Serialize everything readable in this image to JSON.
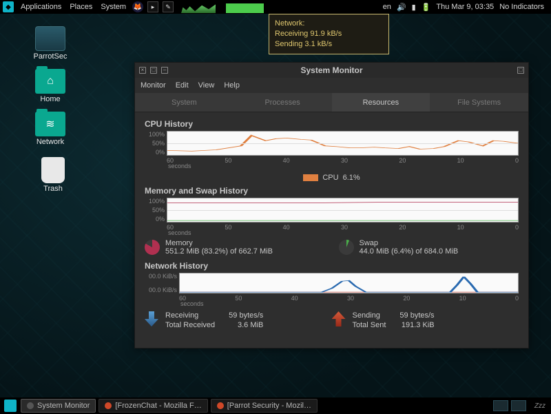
{
  "top_panel": {
    "menus": [
      "Applications",
      "Places",
      "System"
    ],
    "lang": "en",
    "datetime": "Thu Mar  9, 03:35",
    "indicators": "No Indicators"
  },
  "tooltip": {
    "title": "Network:",
    "recv": "Receiving 91.9 kB/s",
    "send": "Sending 3.1 kB/s"
  },
  "desktop_icons": {
    "parrot": "ParrotSec",
    "home": "Home",
    "network": "Network",
    "trash": "Trash"
  },
  "window": {
    "title": "System Monitor",
    "menus": [
      "Monitor",
      "Edit",
      "View",
      "Help"
    ],
    "tabs": [
      "System",
      "Processes",
      "Resources",
      "File Systems"
    ],
    "active_tab": 2,
    "cpu": {
      "title": "CPU History",
      "ylabels": [
        "100%",
        "50%",
        "0%"
      ],
      "xlabels": [
        "60",
        "50",
        "40",
        "30",
        "20",
        "10",
        "0"
      ],
      "xunit": "seconds",
      "legend_label": "CPU",
      "legend_value": "6.1%",
      "color": "#e08040"
    },
    "mem": {
      "title": "Memory and Swap History",
      "ylabels": [
        "100%",
        "50%",
        "0%"
      ],
      "xlabels": [
        "60",
        "50",
        "40",
        "30",
        "20",
        "10",
        "0"
      ],
      "xunit": "seconds",
      "memory_label": "Memory",
      "memory_line": "551.2 MiB (83.2%) of 662.7 MiB",
      "swap_label": "Swap",
      "swap_line": "44.0 MiB (6.4%) of 684.0 MiB"
    },
    "net": {
      "title": "Network History",
      "ylabels": [
        "00.0 KiB/s",
        "00.0 KiB/s"
      ],
      "xlabels": [
        "60",
        "50",
        "40",
        "30",
        "20",
        "10",
        "0"
      ],
      "xunit": "seconds",
      "recv_label": "Receiving",
      "recv_rate": "59 bytes/s",
      "recv_total_label": "Total Received",
      "recv_total": "3.6 MiB",
      "send_label": "Sending",
      "send_rate": "59 bytes/s",
      "send_total_label": "Total Sent",
      "send_total": "191.3 KiB"
    }
  },
  "taskbar": {
    "tasks": [
      {
        "label": "System Monitor",
        "color": "#3a3a3a",
        "active": true
      },
      {
        "label": "[FrozenChat - Mozilla F…",
        "color": "#d04828",
        "active": false
      },
      {
        "label": "[Parrot Security - Mozil…",
        "color": "#d04828",
        "active": false
      }
    ],
    "sleep": "Zzz"
  },
  "chart_data": [
    {
      "type": "line",
      "title": "CPU History",
      "xlabel": "seconds",
      "ylabel": "%",
      "xlim": [
        60,
        0
      ],
      "ylim": [
        0,
        100
      ],
      "series": [
        {
          "name": "CPU",
          "color": "#e08040",
          "x": [
            60,
            56,
            52,
            48,
            46,
            44,
            42,
            40,
            38,
            36,
            34,
            32,
            30,
            28,
            26,
            24,
            22,
            20,
            18,
            16,
            14,
            12,
            10,
            8,
            6,
            4,
            2,
            0
          ],
          "y": [
            20,
            18,
            22,
            40,
            85,
            60,
            70,
            72,
            68,
            65,
            40,
            35,
            30,
            30,
            32,
            30,
            28,
            35,
            25,
            28,
            35,
            60,
            55,
            40,
            60,
            58,
            62,
            50
          ]
        }
      ]
    },
    {
      "type": "line",
      "title": "Memory and Swap History",
      "xlabel": "seconds",
      "ylabel": "%",
      "xlim": [
        60,
        0
      ],
      "ylim": [
        0,
        100
      ],
      "series": [
        {
          "name": "Memory",
          "color": "#b03050",
          "x": [
            60,
            0
          ],
          "y": [
            82,
            84
          ]
        },
        {
          "name": "Swap",
          "color": "#4aaf4a",
          "x": [
            60,
            0
          ],
          "y": [
            6,
            6
          ]
        }
      ]
    },
    {
      "type": "line",
      "title": "Network History",
      "xlabel": "seconds",
      "ylabel": "KiB/s",
      "xlim": [
        60,
        0
      ],
      "ylim": [
        0,
        100
      ],
      "series": [
        {
          "name": "Receiving",
          "color": "#2a6ab0",
          "x": [
            60,
            35,
            33,
            31,
            29,
            27,
            25,
            12,
            10,
            8,
            6,
            4,
            0
          ],
          "y": [
            2,
            2,
            20,
            55,
            58,
            30,
            2,
            2,
            40,
            85,
            50,
            2,
            2
          ]
        },
        {
          "name": "Sending",
          "color": "#c03020",
          "x": [
            60,
            0
          ],
          "y": [
            1,
            1
          ]
        }
      ]
    }
  ]
}
